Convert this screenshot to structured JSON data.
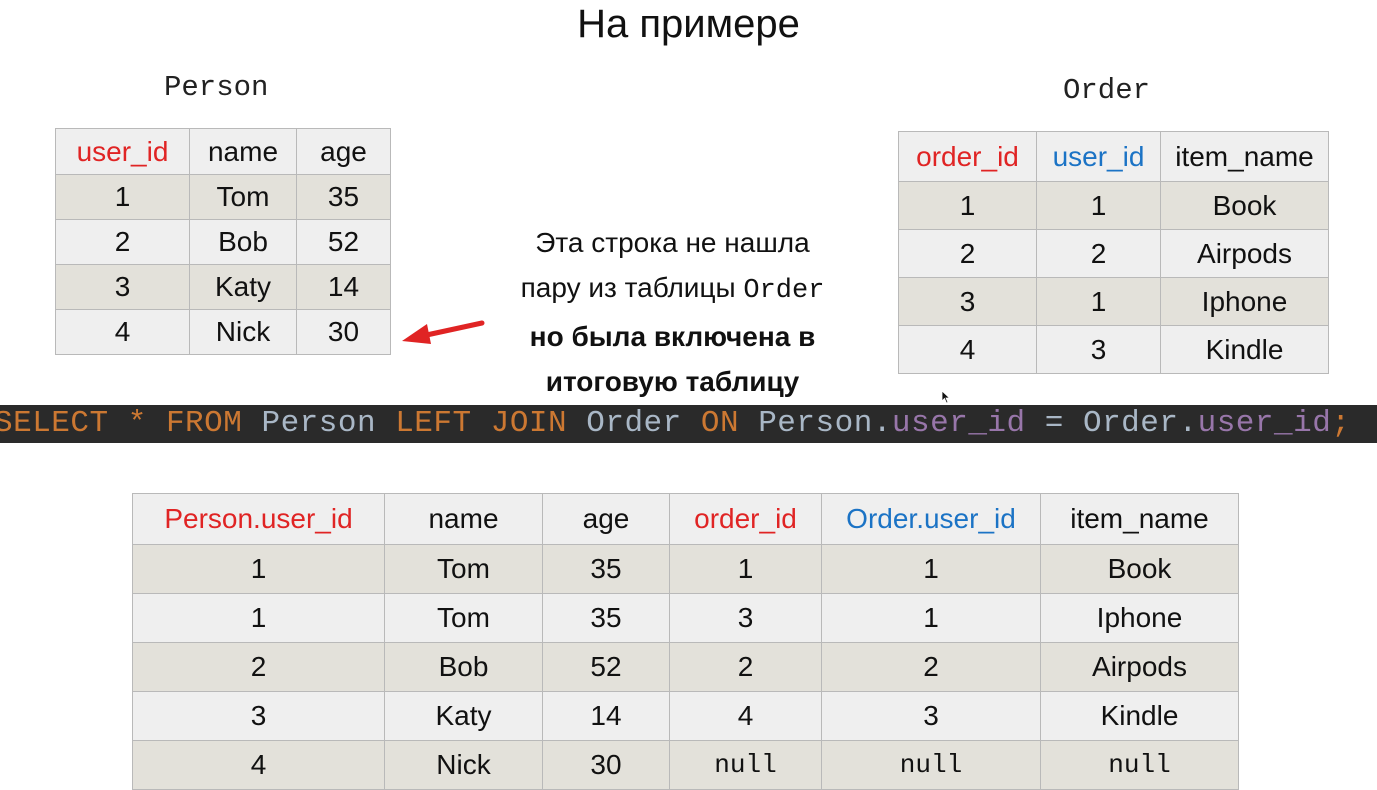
{
  "slide": {
    "title": "На примере"
  },
  "person": {
    "caption": "Person",
    "headers": [
      "user_id",
      "name",
      "age"
    ],
    "rows": [
      [
        "1",
        "Tom",
        "35"
      ],
      [
        "2",
        "Bob",
        "52"
      ],
      [
        "3",
        "Katy",
        "14"
      ],
      [
        "4",
        "Nick",
        "30"
      ]
    ]
  },
  "order": {
    "caption": "Order",
    "headers": [
      "order_id",
      "user_id",
      "item_name"
    ],
    "rows": [
      [
        "1",
        "1",
        "Book"
      ],
      [
        "2",
        "2",
        "Airpods"
      ],
      [
        "3",
        "1",
        "Iphone"
      ],
      [
        "4",
        "3",
        "Kindle"
      ]
    ]
  },
  "note": {
    "line1": "Эта строка не нашла",
    "line2_text": "пару из таблицы ",
    "line2_code": "Order",
    "line3": "но была включена в",
    "line4": "итоговую таблицу"
  },
  "sql": {
    "tokens": [
      {
        "text": "SELECT",
        "kind": "kw"
      },
      {
        "text": " ",
        "kind": "id"
      },
      {
        "text": "*",
        "kind": "kw"
      },
      {
        "text": " ",
        "kind": "id"
      },
      {
        "text": "FROM",
        "kind": "kw"
      },
      {
        "text": " Person ",
        "kind": "id"
      },
      {
        "text": "LEFT JOIN",
        "kind": "kw"
      },
      {
        "text": " Order ",
        "kind": "id"
      },
      {
        "text": "ON",
        "kind": "kw"
      },
      {
        "text": " Person.",
        "kind": "id"
      },
      {
        "text": "user_id",
        "kind": "col"
      },
      {
        "text": " = Order.",
        "kind": "id"
      },
      {
        "text": "user_id",
        "kind": "col"
      },
      {
        "text": ";",
        "kind": "kw"
      }
    ]
  },
  "result": {
    "headers": [
      "Person.user_id",
      "name",
      "age",
      "order_id",
      "Order.user_id",
      "item_name"
    ],
    "rows": [
      [
        "1",
        "Tom",
        "35",
        "1",
        "1",
        "Book"
      ],
      [
        "1",
        "Tom",
        "35",
        "3",
        "1",
        "Iphone"
      ],
      [
        "2",
        "Bob",
        "52",
        "2",
        "2",
        "Airpods"
      ],
      [
        "3",
        "Katy",
        "14",
        "4",
        "3",
        "Kindle"
      ],
      [
        "4",
        "Nick",
        "30",
        "null",
        "null",
        "null"
      ]
    ]
  },
  "colors": {
    "key_red": "#e02424",
    "key_blue": "#1b73c5",
    "arrow_red": "#e02424",
    "sql_background": "#2a2a2a"
  },
  "icons": {
    "arrow": "left-arrow-icon",
    "cursor": "mouse-cursor-icon"
  }
}
